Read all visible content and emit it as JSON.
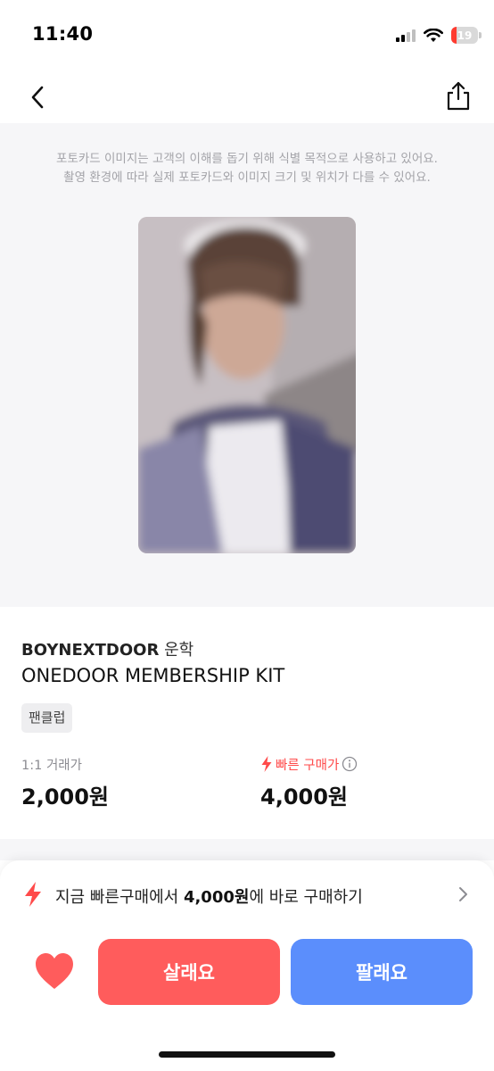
{
  "status_bar": {
    "time": "11:40",
    "battery": "19",
    "battery_level": 0.19
  },
  "icons": {
    "signal": "cellular-signal-icon",
    "wifi": "wifi-icon",
    "back": "chevron-left-icon",
    "share": "share-icon",
    "fast": "lightning-bolt-icon",
    "info": "info-icon",
    "chevron": "chevron-right-icon",
    "like": "heart-icon"
  },
  "notice": {
    "line1": "포토카드 이미지는 고객의 이해를 돕기 위해 식별 목적으로 사용하고 있어요.",
    "line2": "촬영 환경에 따라 실제 포토카드와 이미지 크기 및 위치가 다를 수 있어요."
  },
  "product": {
    "artist": "BOYNEXTDOOR",
    "member": "운학",
    "album": "ONEDOOR MEMBERSHIP KIT",
    "tag": "팬클럽"
  },
  "prices": {
    "trade_label": "1:1 거래가",
    "trade_value": "2,000원",
    "fast_label": "빠른 구매가",
    "fast_value": "4,000원"
  },
  "fast_banner": {
    "prefix": "지금 빠른구매에서",
    "amount": "4,000원",
    "suffix": "에 바로 구매하기"
  },
  "actions": {
    "buy": "살래요",
    "sell": "팔래요"
  },
  "colors": {
    "accent_red": "#ff5c5c",
    "accent_blue": "#5b8efc",
    "fast_red": "#ff4a4a"
  }
}
